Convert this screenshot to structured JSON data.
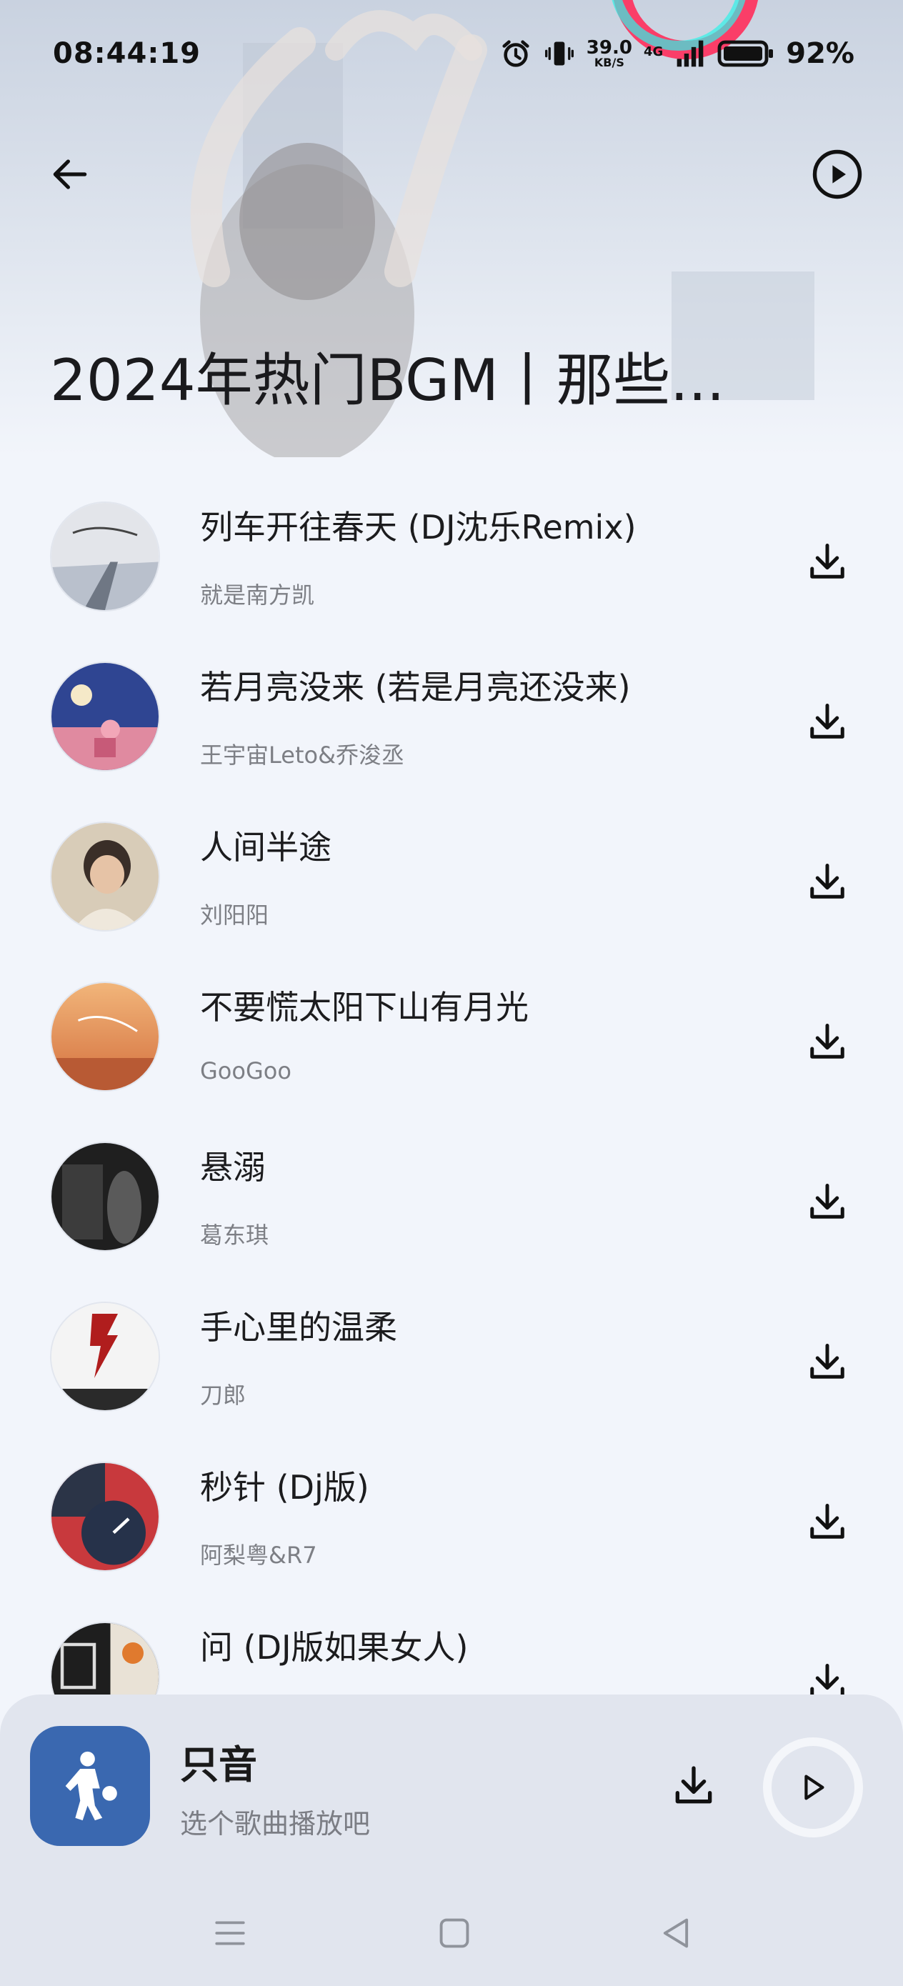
{
  "status_bar": {
    "time": "08:44:19",
    "speed_value": "39.0",
    "speed_unit": "KB/S",
    "network": "4G",
    "battery": "92%",
    "icons": [
      "alarm-icon",
      "vibrate-icon",
      "signal-icon",
      "battery-icon"
    ]
  },
  "header": {
    "title": "2024年热门BGM丨那些..."
  },
  "songs": [
    {
      "title": "列车开往春天 (DJ沈乐Remix)",
      "artist": "就是南方凯",
      "cover_color": "#d9dde3"
    },
    {
      "title": "若月亮没来 (若是月亮还没来)",
      "artist": "王宇宙Leto&乔浚丞",
      "cover_color": "#2a3d7a"
    },
    {
      "title": "人间半途",
      "artist": "刘阳阳",
      "cover_color": "#c9b89f"
    },
    {
      "title": "不要慌太阳下山有月光",
      "artist": "GooGoo",
      "cover_color": "#e0915a"
    },
    {
      "title": "悬溺",
      "artist": "葛东琪",
      "cover_color": "#2b2b2b"
    },
    {
      "title": "手心里的温柔",
      "artist": "刀郎",
      "cover_color": "#efefef"
    },
    {
      "title": "秒针 (Dj版)",
      "artist": "阿梨粤&R7",
      "cover_color": "#c8393d"
    },
    {
      "title": "问 (DJ版如果女人)",
      "artist": "",
      "cover_color": "#1e1e1e"
    }
  ],
  "player": {
    "app_name": "只音",
    "hint": "选个歌曲播放吧",
    "art_color": "#3a68b0"
  },
  "colors": {
    "background": "#f2f5fb",
    "player_bar": "#e1e5ee",
    "secondary_text": "#7d7f85"
  }
}
